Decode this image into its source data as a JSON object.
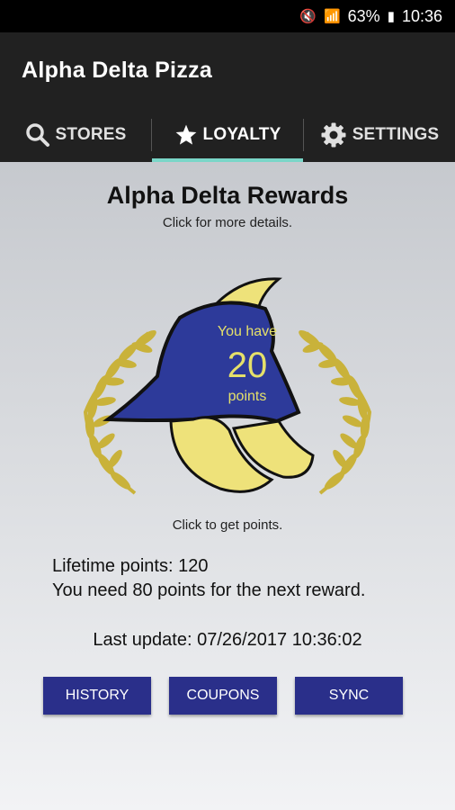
{
  "status_bar": {
    "battery": "63%",
    "time": "10:36"
  },
  "app": {
    "title": "Alpha Delta Pizza"
  },
  "tabs": [
    {
      "label": "STORES",
      "icon": "search-icon"
    },
    {
      "label": "LOYALTY",
      "icon": "star-icon"
    },
    {
      "label": "SETTINGS",
      "icon": "gear-icon"
    }
  ],
  "rewards": {
    "title": "Alpha Delta Rewards",
    "details_hint": "Click for more details.",
    "badge_line1": "You have",
    "points": "20",
    "badge_line3": "points",
    "get_points_hint": "Click to get points.",
    "lifetime": "Lifetime points: 120",
    "next_reward": "You need 80 points for the next reward.",
    "last_update": "Last update: 07/26/2017 10:36:02"
  },
  "buttons": {
    "history": "HISTORY",
    "coupons": "COUPONS",
    "sync": "SYNC"
  },
  "colors": {
    "appbar": "#212121",
    "tab_indicator": "#7ad6c8",
    "button": "#2a2f8a",
    "laurel": "#c9b23a",
    "helmet": "#2d3a9a",
    "helmet_crest": "#eee27a"
  }
}
